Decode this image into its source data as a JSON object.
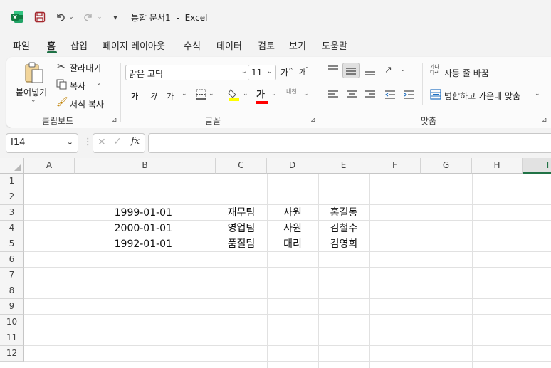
{
  "titlebar": {
    "document_title": "통합 문서1",
    "separator": "-",
    "app_name": "Excel",
    "customize_label": "▾"
  },
  "tabs": [
    "파일",
    "홈",
    "삽입",
    "페이지 레이아웃",
    "수식",
    "데이터",
    "검토",
    "보기",
    "도움말"
  ],
  "ribbon": {
    "clipboard": {
      "paste_label": "붙여넣기",
      "cut_label": "잘라내기",
      "copy_label": "복사",
      "format_painter_label": "서식 복사",
      "group_label": "클립보드"
    },
    "font": {
      "font_name": "맑은 고딕",
      "font_size": "11",
      "bold_label": "가",
      "italic_label": "가",
      "underline_label": "가",
      "font_color_label": "가",
      "phonetic_label": "내천",
      "group_label": "글꼴",
      "fill_color": "#ffff00",
      "text_color": "#ff0000"
    },
    "alignment": {
      "wrap_text_label": "자동 줄 바꿈",
      "merge_center_label": "병합하고 가운데 맞춤",
      "group_label": "맞춤"
    }
  },
  "formula_bar": {
    "name_box": "I14",
    "formula": ""
  },
  "sheet": {
    "columns": [
      "A",
      "B",
      "C",
      "D",
      "E",
      "F",
      "G",
      "H",
      "I"
    ],
    "rows": [
      "1",
      "2",
      "3",
      "4",
      "5",
      "6",
      "7",
      "8",
      "9",
      "10",
      "11",
      "12"
    ],
    "data": [
      {
        "row": "3",
        "B": "1999-01-01",
        "C": "재무팀",
        "D": "사원",
        "E": "홍길동"
      },
      {
        "row": "4",
        "B": "2000-01-01",
        "C": "영업팀",
        "D": "사원",
        "E": "김철수"
      },
      {
        "row": "5",
        "B": "1992-01-01",
        "C": "품질팀",
        "D": "대리",
        "E": "김영희"
      }
    ]
  },
  "colors": {
    "accent": "#217346",
    "excel_icon": "#107c41",
    "save_icon": "#a4262c"
  }
}
